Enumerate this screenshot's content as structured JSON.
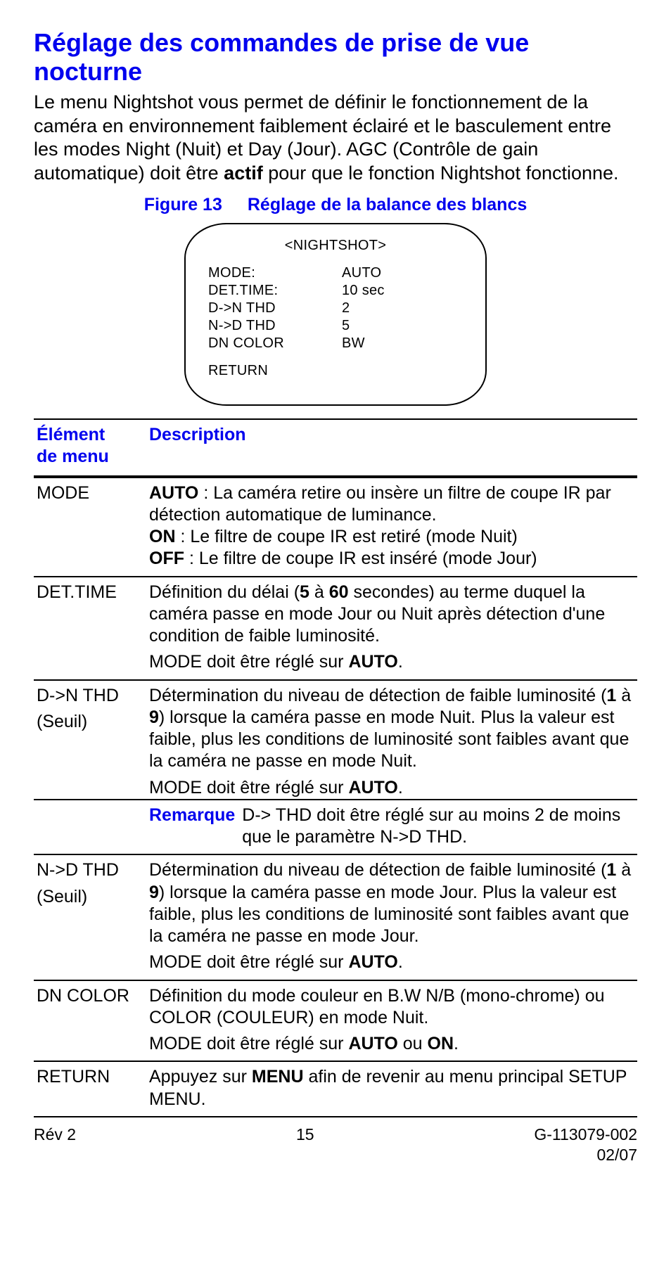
{
  "title": "Réglage des commandes de prise de vue nocturne",
  "intro_pre": "Le menu Nightshot vous permet de définir le fonctionnement de la caméra en environnement faiblement éclairé et le basculement entre les modes Night (Nuit) et Day (Jour). AGC (Contrôle de gain automatique) doit être ",
  "intro_bold": "actif",
  "intro_post": " pour que le fonction Nightshot fonctionne.",
  "figure_label": "Figure 13",
  "figure_caption": "Réglage de la balance des blancs",
  "crt": {
    "title": "<NIGHTSHOT>",
    "rows": [
      {
        "k": "MODE:",
        "v": "AUTO"
      },
      {
        "k": "DET.TIME:",
        "v": "10 sec"
      },
      {
        "k": "D->N THD",
        "v": "2"
      },
      {
        "k": "N->D THD",
        "v": "5"
      },
      {
        "k": "DN COLOR",
        "v": "BW"
      }
    ],
    "return": "RETURN"
  },
  "headers": {
    "col1a": "Élément",
    "col1b": "de menu",
    "col2": "Description"
  },
  "rows": {
    "mode": {
      "name": "MODE",
      "auto_lbl": "AUTO",
      "auto_txt": " : La caméra retire ou insère un filtre de coupe IR par détection automatique de luminance.",
      "on_lbl": "ON",
      "on_txt": " : Le filtre de coupe IR est retiré (mode Nuit)",
      "off_lbl": "OFF",
      "off_txt": " : Le filtre de coupe IR est inséré (mode Jour)"
    },
    "dettime": {
      "name": "DET.TIME",
      "p1a": "Définition du délai (",
      "p1b": "5",
      "p1c": " à ",
      "p1d": "60",
      "p1e": " secondes) au terme duquel la caméra passe en mode Jour ou Nuit après détection d'une condition de faible luminosité.",
      "p2a": "MODE doit être réglé sur ",
      "p2b": "AUTO",
      "p2c": "."
    },
    "dnthd": {
      "name1": "D->N THD",
      "name2": "(Seuil)",
      "p1a": "Détermination du niveau de détection de faible luminosité (",
      "p1b": "1",
      "p1c": " à ",
      "p1d": "9",
      "p1e": ") lorsque la caméra passe en mode Nuit. Plus la valeur est faible, plus les conditions de luminosité sont faibles avant que la caméra ne passe en mode Nuit.",
      "p2a": "MODE doit être réglé sur ",
      "p2b": "AUTO",
      "p2c": ".",
      "note_lbl": "Remarque",
      "note_txt": "D-> THD doit être réglé sur au moins 2 de moins que le paramètre N->D THD."
    },
    "ndthd": {
      "name1": "N->D THD",
      "name2": "(Seuil)",
      "p1a": "Détermination du niveau de détection de faible luminosité (",
      "p1b": "1",
      "p1c": " à ",
      "p1d": "9",
      "p1e": ") lorsque la caméra passe en mode Jour. Plus la valeur est faible, plus les conditions de luminosité sont faibles avant que la caméra ne passe en mode Jour.",
      "p2a": "MODE doit être réglé sur ",
      "p2b": "AUTO",
      "p2c": "."
    },
    "dncolor": {
      "name": "DN COLOR",
      "p1": "Définition du mode couleur en B.W N/B (mono-chrome) ou COLOR (COULEUR) en mode Nuit.",
      "p2a": "MODE doit être réglé sur ",
      "p2b": "AUTO",
      "p2c": " ou ",
      "p2d": "ON",
      "p2e": "."
    },
    "ret": {
      "name": "RETURN",
      "p1a": "Appuyez sur ",
      "p1b": "MENU",
      "p1c": " afin de revenir au menu principal SETUP MENU."
    }
  },
  "footer": {
    "left": "Rév 2",
    "center": "15",
    "right1": "G-113079-002",
    "right2": "02/07"
  }
}
